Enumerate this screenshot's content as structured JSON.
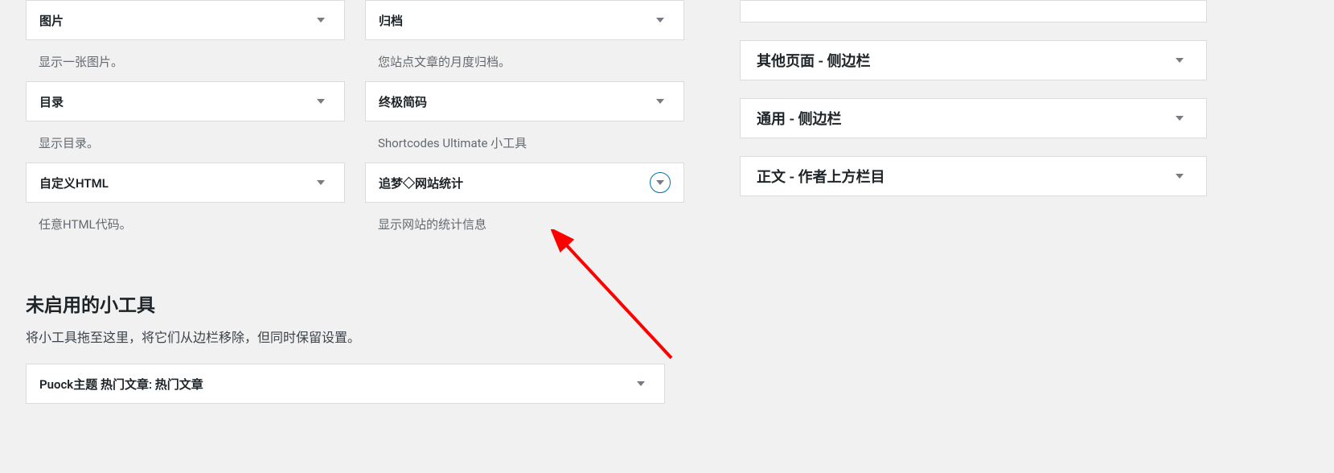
{
  "widgets": {
    "left_col": [
      {
        "title": "图片",
        "desc": "显示一张图片。"
      },
      {
        "title": "目录",
        "desc": "显示目录。"
      },
      {
        "title": "自定义HTML",
        "desc": "任意HTML代码。"
      }
    ],
    "right_col": [
      {
        "title": "归档",
        "desc": "您站点文章的月度归档。"
      },
      {
        "title": "终极简码",
        "desc": "Shortcodes Ultimate 小工具"
      },
      {
        "title": "追梦◇网站统计",
        "desc": "显示网站的统计信息",
        "highlighted": true
      }
    ]
  },
  "inactive_section": {
    "heading": "未启用的小工具",
    "desc": "将小工具拖至这里，将它们从边栏移除，但同时保留设置。",
    "item_title": "Puock主题 热门文章: 热门文章"
  },
  "sidebars": [
    {
      "title": "其他页面 - 侧边栏"
    },
    {
      "title": "通用 - 侧边栏"
    },
    {
      "title": "正文 - 作者上方栏目"
    }
  ]
}
